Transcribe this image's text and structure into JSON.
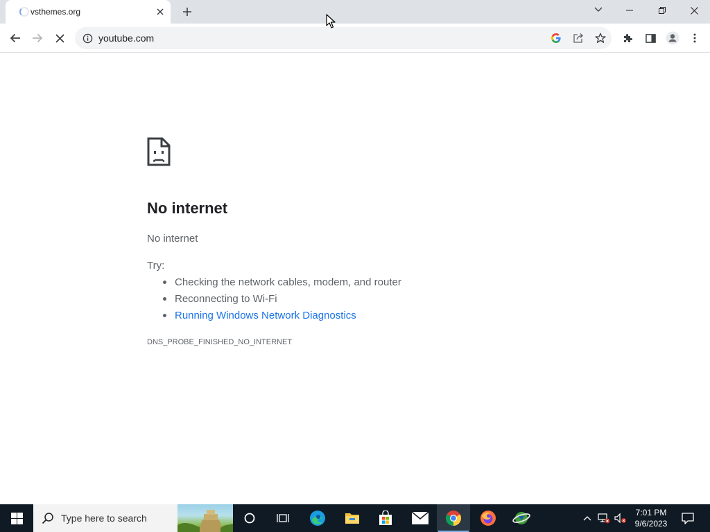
{
  "browser": {
    "tab": {
      "title": "vsthemes.org"
    },
    "omnibox": {
      "url": "youtube.com"
    }
  },
  "error_page": {
    "title": "No internet",
    "subtitle": "No internet",
    "try_label": "Try:",
    "suggestions": [
      "Checking the network cables, modem, and router",
      "Reconnecting to Wi-Fi",
      "Running Windows Network Diagnostics"
    ],
    "error_code": "DNS_PROBE_FINISHED_NO_INTERNET"
  },
  "taskbar": {
    "search_placeholder": "Type here to search",
    "clock": {
      "time": "7:01 PM",
      "date": "9/6/2023"
    },
    "pinned_apps": [
      "cortana-icon",
      "task-view-icon",
      "edge-icon",
      "file-explorer-icon",
      "microsoft-store-icon",
      "mail-icon",
      "chrome-icon",
      "firefox-icon",
      "ie-download-manager-icon"
    ],
    "active_app": "chrome-icon"
  },
  "colors": {
    "link": "#1a73e8",
    "tabstrip_bg": "#dee1e6",
    "taskbar_bg": "#101a24"
  }
}
